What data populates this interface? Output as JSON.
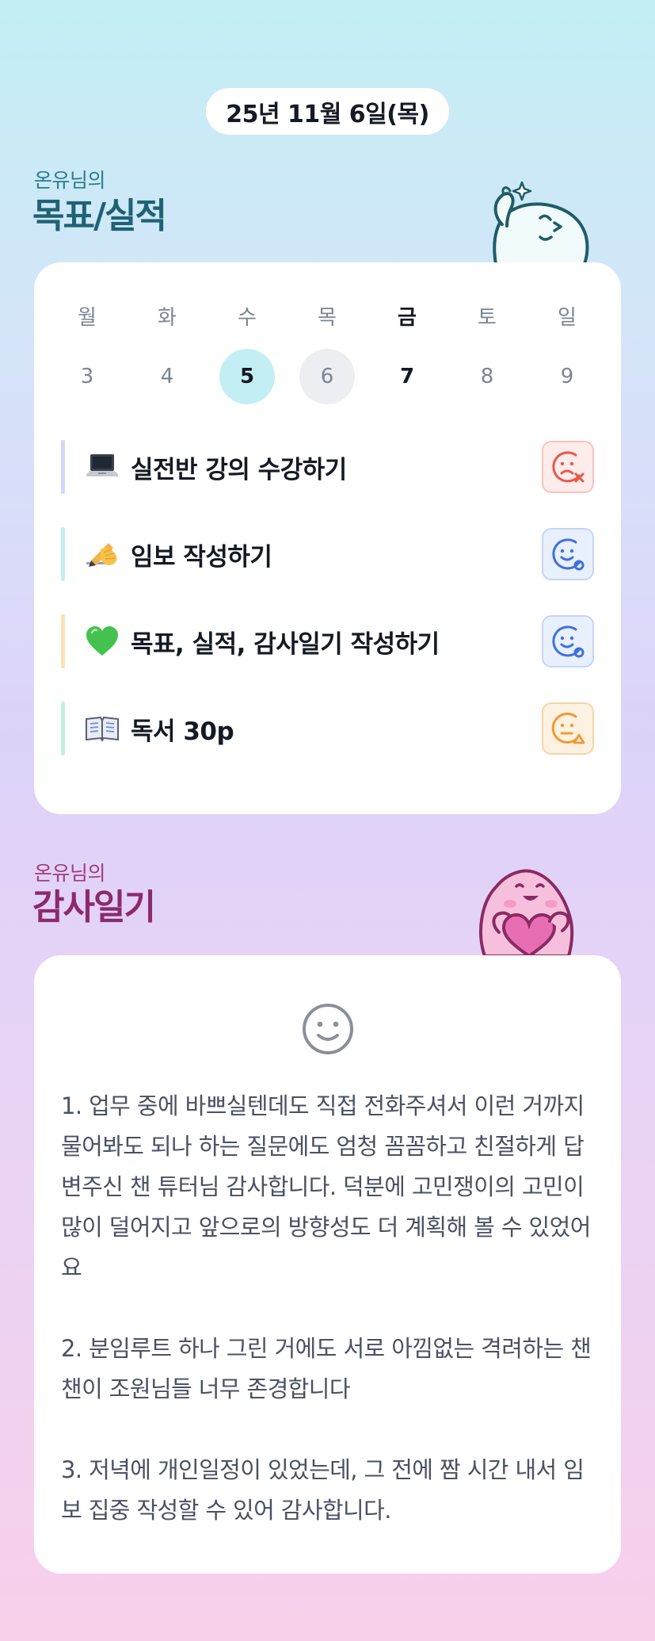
{
  "header": {
    "date": "25년 11월 6일(목)"
  },
  "goals_section": {
    "subtitle": "온유님의",
    "title": "목표/실적"
  },
  "week": {
    "days": [
      {
        "name": "월",
        "num": "3",
        "state": "normal"
      },
      {
        "name": "화",
        "num": "4",
        "state": "normal"
      },
      {
        "name": "수",
        "num": "5",
        "state": "selected"
      },
      {
        "name": "목",
        "num": "6",
        "state": "current"
      },
      {
        "name": "금",
        "num": "7",
        "state": "today"
      },
      {
        "name": "토",
        "num": "8",
        "state": "normal"
      },
      {
        "name": "일",
        "num": "9",
        "state": "normal"
      }
    ]
  },
  "goals": [
    {
      "icon": "laptop-icon",
      "text": "실전반 강의 수강하기",
      "status": "fail",
      "status_icon": "sad-face-x-icon",
      "bar_color": "#cfd8f8"
    },
    {
      "icon": "writing-hand-icon",
      "text": "임보 작성하기",
      "status": "done",
      "status_icon": "happy-face-check-icon",
      "bar_color": "#c5eef3"
    },
    {
      "icon": "green-heart-icon",
      "text": "목표, 실적, 감사일기 작성하기",
      "status": "done",
      "status_icon": "happy-face-check-icon",
      "bar_color": "#fde0b8"
    },
    {
      "icon": "open-book-icon",
      "text": "독서 30p",
      "status": "partial",
      "status_icon": "neutral-face-warning-icon",
      "bar_color": "#bff0e0"
    }
  ],
  "gratitude_section": {
    "subtitle": "온유님의",
    "title": "감사일기"
  },
  "gratitude": {
    "mood_icon": "smile-face-icon",
    "entries": [
      "1. 업무 중에 바쁘실텐데도 직접 전화주셔서 이런 거까지 물어봐도 되나 하는 질문에도 엄청 꼼꼼하고 친절하게 답변주신 챈 튜터님 감사합니다. 덕분에 고민쟁이의 고민이 많이 덜어지고 앞으로의 방향성도 더 계획해 볼 수 있었어요",
      "2. 분임루트 하나 그린 거에도 서로 아낌없는 격려하는 챈챈이 조원님들 너무 존경합니다",
      "3. 저녁에 개인일정이 있었는데, 그 전에 짬 시간 내서 임보 집중 작성할 수 있어 감사합니다."
    ]
  },
  "colors": {
    "accent_teal": "#1f6273",
    "accent_pink": "#8c2a6b",
    "status_fail": "#e8574a",
    "status_done": "#3f6fe0",
    "status_partial": "#f09a34"
  }
}
